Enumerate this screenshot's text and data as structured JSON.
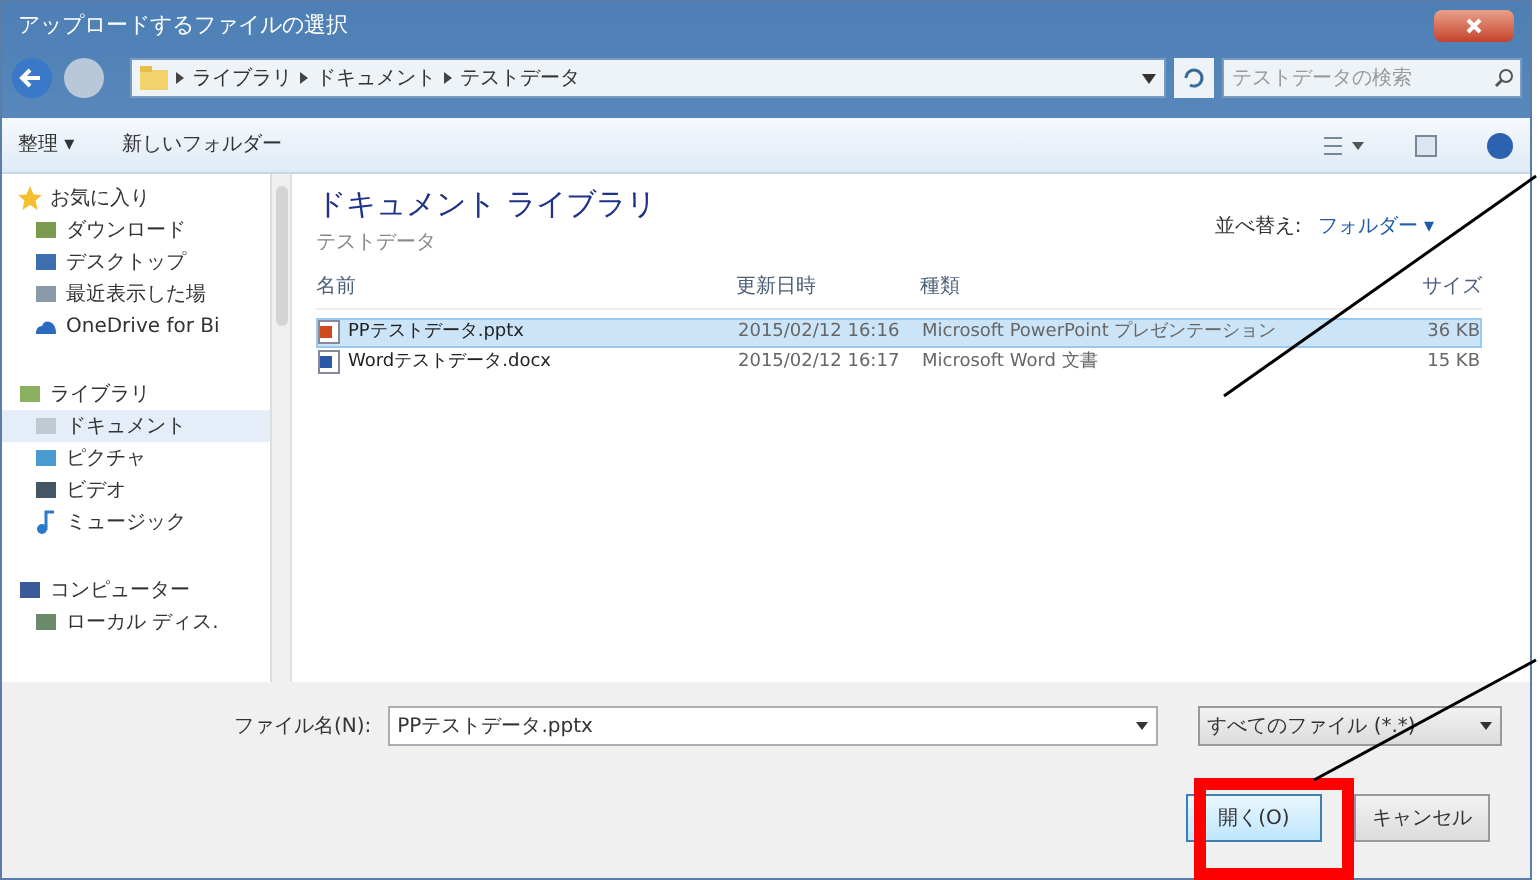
{
  "window": {
    "title": "アップロードするファイルの選択"
  },
  "address_bar": {
    "path": [
      {
        "label": "ライブラリ"
      },
      {
        "label": "ドキュメント"
      },
      {
        "label": "テストデータ"
      }
    ]
  },
  "search": {
    "placeholder": "テストデータの検索"
  },
  "toolbar": {
    "items": [
      {
        "label": "整理 ▾"
      },
      {
        "label": "新しいフォルダー"
      }
    ]
  },
  "sidebar": {
    "groups": [
      {
        "label": "お気に入り",
        "children": [
          {
            "label": "ダウンロード",
            "selected": false
          },
          {
            "label": "デスクトップ",
            "selected": false
          },
          {
            "label": "最近表示した場",
            "selected": false
          },
          {
            "label": "OneDrive for Bi",
            "selected": false
          }
        ]
      },
      {
        "label": "ライブラリ",
        "children": [
          {
            "label": "ドキュメント",
            "selected": true
          },
          {
            "label": "ピクチャ",
            "selected": false
          },
          {
            "label": "ビデオ",
            "selected": false
          },
          {
            "label": "ミュージック",
            "selected": false
          }
        ]
      },
      {
        "label": "コンピューター",
        "children": [
          {
            "label": "ローカル ディス.",
            "selected": false
          }
        ]
      }
    ]
  },
  "library": {
    "title": "ドキュメント ライブラリ",
    "subtitle": "テストデータ",
    "sort_label": "並べ替え:",
    "sort_value": "フォルダー ▾"
  },
  "table": {
    "columns": [
      "名前",
      "更新日時",
      "種類",
      "サイズ"
    ],
    "rows": [
      {
        "kind": "pptx",
        "cells": [
          "PPテストデータ.pptx",
          "2015/02/12 16:16",
          "Microsoft PowerPoint プレゼンテーション",
          "36 KB"
        ],
        "selected": true
      },
      {
        "kind": "docx",
        "cells": [
          "Wordテストデータ.docx",
          "2015/02/12 16:17",
          "Microsoft Word 文書",
          "15 KB"
        ],
        "selected": false
      }
    ]
  },
  "footer": {
    "filename_label": "ファイル名(N):",
    "filename_value": "PPテストデータ.pptx",
    "filter": "すべてのファイル (*.*)",
    "open_button": "開く(O)",
    "cancel_button": "キャンセル"
  }
}
